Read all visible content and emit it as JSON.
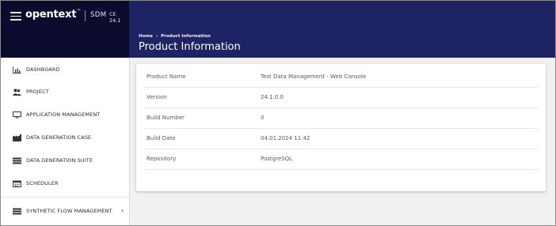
{
  "header": {
    "brand": "opentext",
    "product_code": "SDM",
    "version_tag": "CE 24.1",
    "breadcrumb": {
      "home": "Home",
      "separator": "›",
      "current": "Product Information"
    },
    "page_title": "Product Information"
  },
  "sidebar": {
    "items": [
      {
        "label": "DASHBOARD",
        "icon": "chart-icon"
      },
      {
        "label": "PROJECT",
        "icon": "users-icon"
      },
      {
        "label": "APPLICATION MANAGEMENT",
        "icon": "monitor-icon"
      },
      {
        "label": "DATA GENERATION CASE",
        "icon": "factory-icon"
      },
      {
        "label": "DATA GENERATION SUITE",
        "icon": "list-icon"
      },
      {
        "label": "SCHEDULER",
        "icon": "calendar-icon"
      },
      {
        "label": "SYNTHETIC FLOW MANAGEMENT",
        "icon": "list-icon",
        "chevron": "‹"
      }
    ]
  },
  "product_info": {
    "rows": [
      {
        "key": "Product Name",
        "value": "Test Data Management - Web Console"
      },
      {
        "key": "Version",
        "value": "24.1.0.0"
      },
      {
        "key": "Build Number",
        "value": "0"
      },
      {
        "key": "Build Date",
        "value": "04.01.2024 11:42"
      },
      {
        "key": "Repository",
        "value": "PostgreSQL"
      }
    ]
  },
  "colors": {
    "header_dark": "#0b0b2e",
    "header_blue": "#1d2363",
    "content_bg": "#f1f1f1"
  }
}
